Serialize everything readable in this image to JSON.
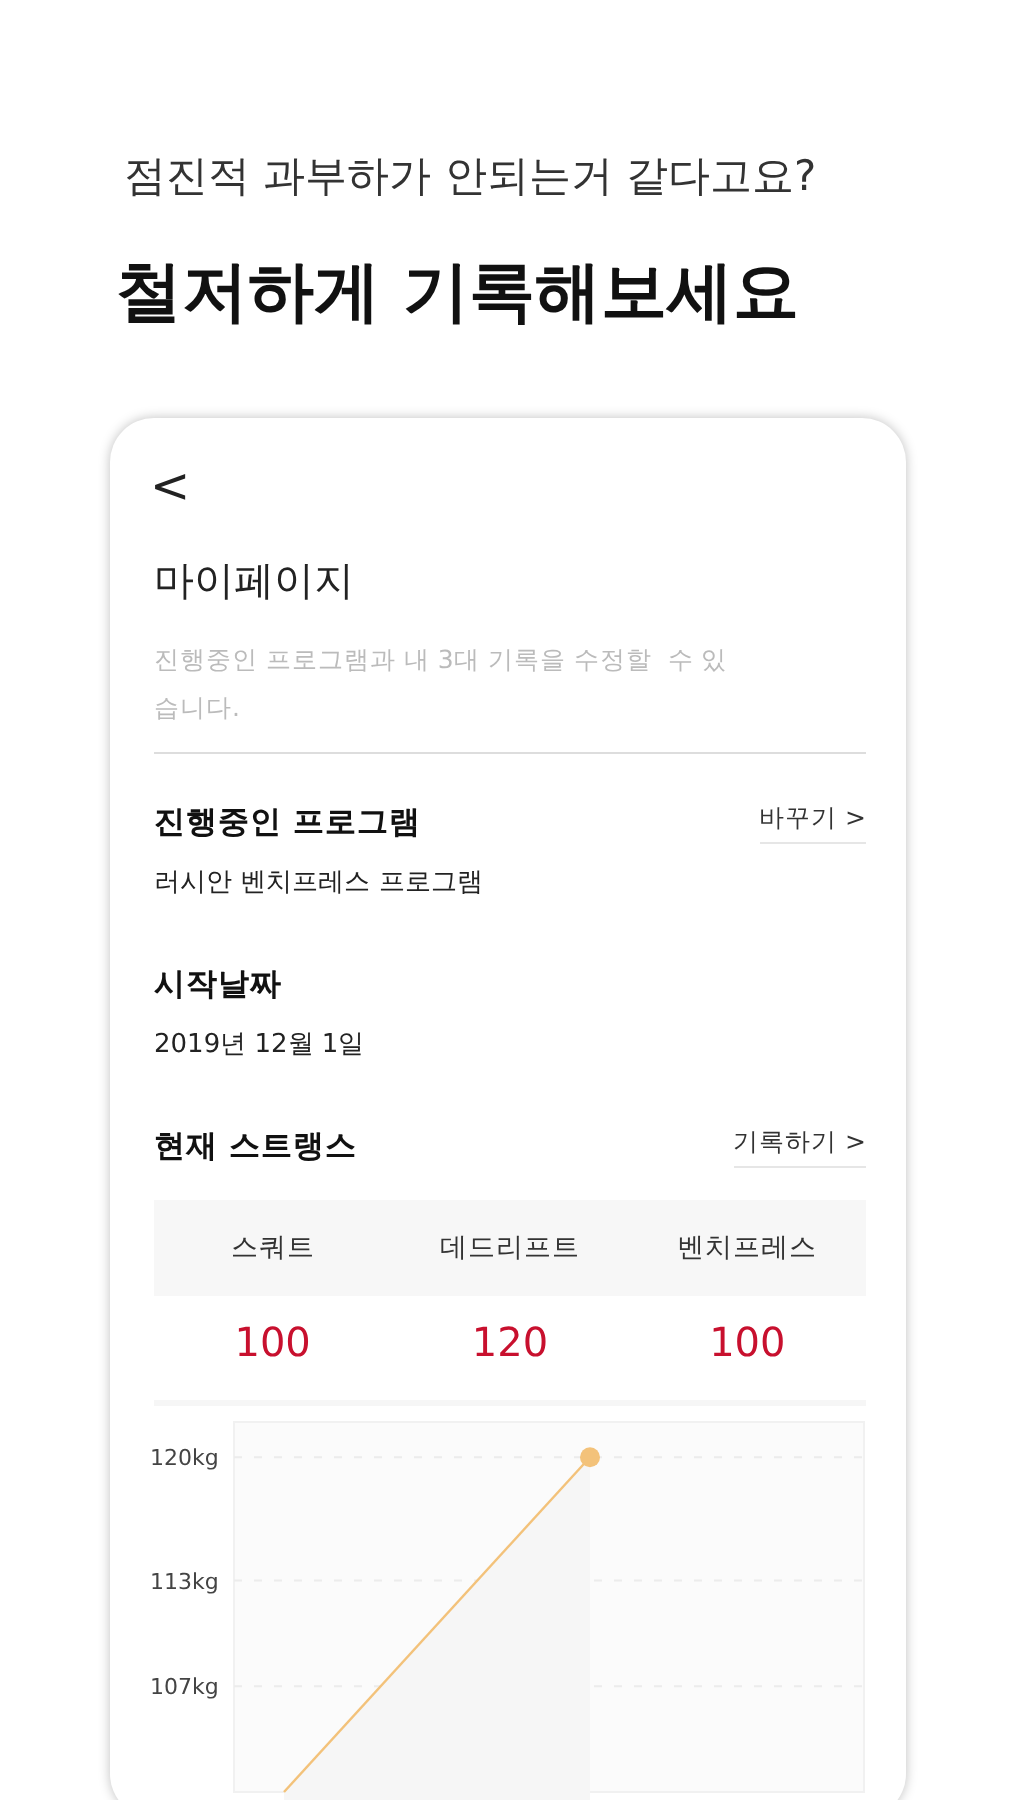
{
  "promo": {
    "subtitle": "점진적 과부하가 안되는거 같다고요?",
    "title": "철저하게 기록해보세요"
  },
  "page": {
    "back": "<",
    "title": "마이페이지",
    "description": "진행중인 프로그램과 내 3대 기록을 수정할  수 있습니다."
  },
  "sections": [
    {
      "label": "진행중인 프로그램",
      "value": "러시안 벤치프레스 프로그램",
      "action": "바꾸기 >"
    },
    {
      "label": "시작날짜",
      "value": "2019년 12월 1일"
    }
  ],
  "strength": {
    "label": "현재 스트랭스",
    "action": "기록하기 >",
    "lifts": [
      {
        "name": "스쿼트",
        "value": "100"
      },
      {
        "name": "데드리프트",
        "value": "120"
      },
      {
        "name": "벤치프레스",
        "value": "100"
      }
    ],
    "chart_data": {
      "type": "area",
      "grid": true,
      "ylim": [
        101,
        122
      ],
      "series": [
        {
          "color": "#f3c27a",
          "values": [
            101,
            120
          ]
        }
      ],
      "yticks": [
        {
          "value": 120,
          "label": "120kg"
        },
        {
          "value": 113,
          "label": "113kg"
        },
        {
          "value": 107,
          "label": "107kg"
        }
      ]
    }
  }
}
